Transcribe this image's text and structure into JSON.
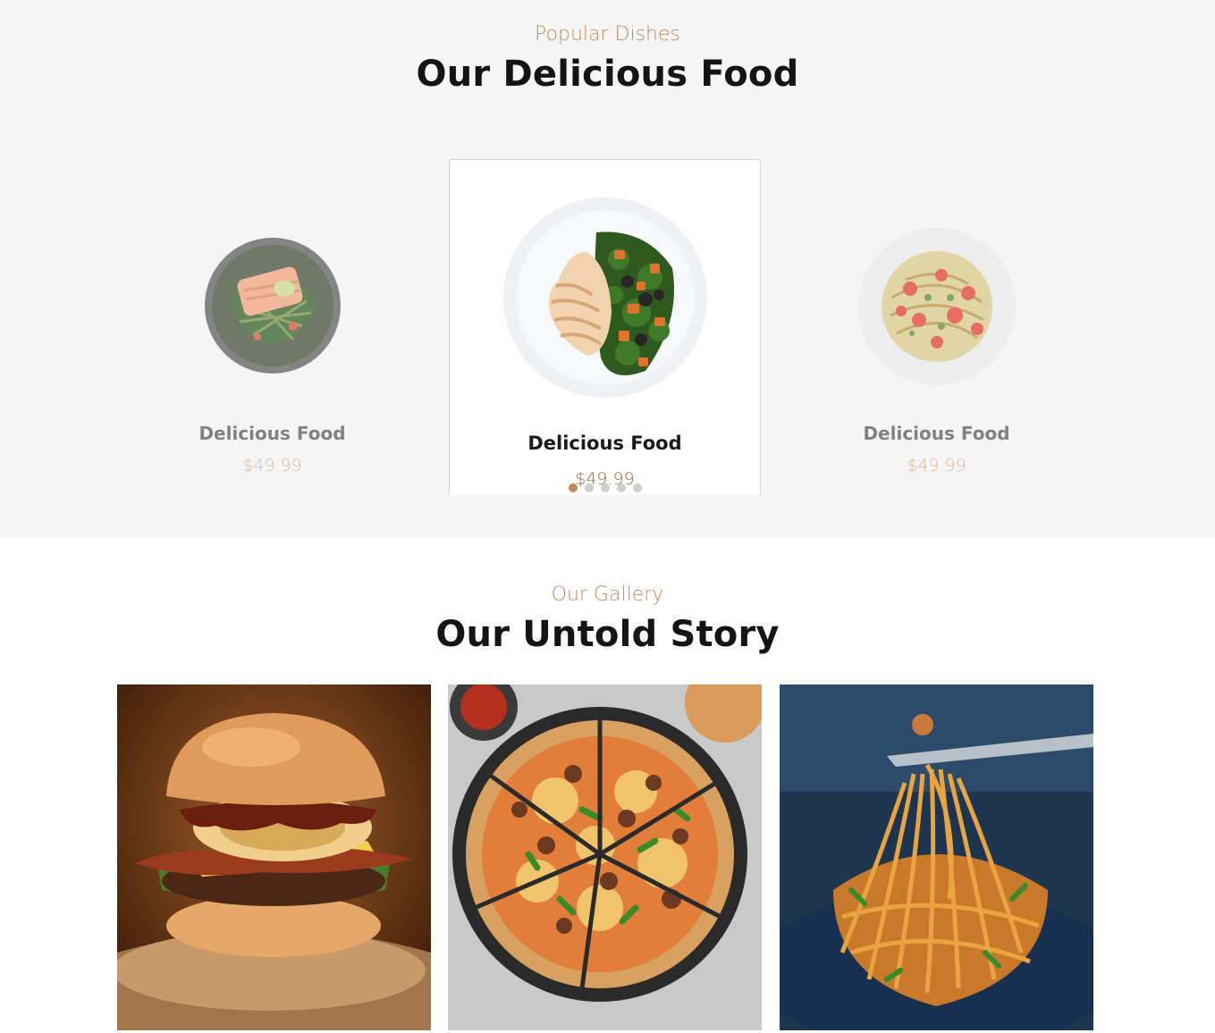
{
  "popular": {
    "eyebrow": "Popular Dishes",
    "title": "Our Delicious Food",
    "cards": [
      {
        "name": "Delicious Food",
        "price": "$49.99",
        "image": "salmon-greens-bowl"
      },
      {
        "name": "Delicious Food",
        "price": "$49.99",
        "image": "chicken-quinoa-salad-plate"
      },
      {
        "name": "Delicious Food",
        "price": "$49.99",
        "image": "noodle-tomato-salad-plate"
      }
    ],
    "carousel": {
      "total_dots": 5,
      "active_index": 0
    }
  },
  "gallery": {
    "eyebrow": "Our Gallery",
    "title": "Our Untold Story",
    "images": [
      "burger",
      "pizza",
      "noodles"
    ]
  },
  "colors": {
    "accent": "#c48b58",
    "section_bg": "#f5f5f5"
  }
}
